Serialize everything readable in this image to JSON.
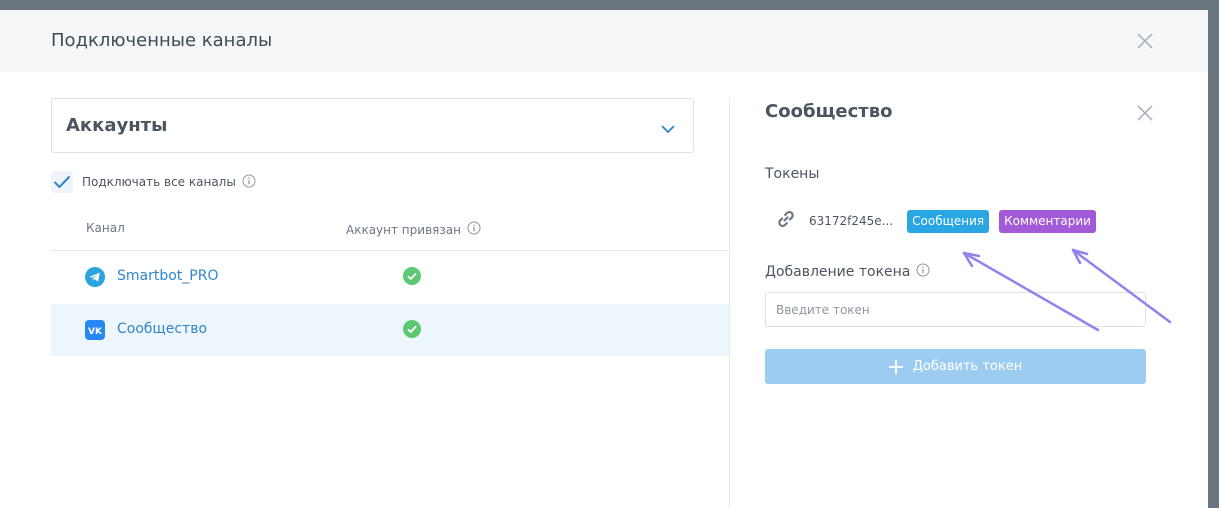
{
  "modal": {
    "title": "Подключенные каналы"
  },
  "left": {
    "select": {
      "value": "Аккаунты",
      "icon": "chevron-down-icon"
    },
    "checkbox": {
      "label": "Подключать все каналы",
      "checked": true
    },
    "table": {
      "headers": [
        "Канал",
        "Аккаунт привязан"
      ],
      "rows": [
        {
          "name": "Smartbot_PRO",
          "channel_icon": "telegram-icon",
          "linked": true,
          "selected": false
        },
        {
          "name": "Сообщество",
          "channel_icon": "vk-icon",
          "linked": true,
          "selected": true
        }
      ]
    }
  },
  "right": {
    "title": "Сообщество",
    "tokens_label": "Токены",
    "token": {
      "value": "63172f245e...",
      "badges": [
        {
          "label": "Сообщения",
          "color": "#29a6e3"
        },
        {
          "label": "Комментарии",
          "color": "#a25ad8"
        }
      ]
    },
    "add_token_label": "Добавление токена",
    "input_placeholder": "Введите токен",
    "add_button_label": "Добавить токен"
  },
  "colors": {
    "accent": "#2f86c9",
    "success": "#5cc972",
    "annotation_arrow": "#8f84ee"
  }
}
